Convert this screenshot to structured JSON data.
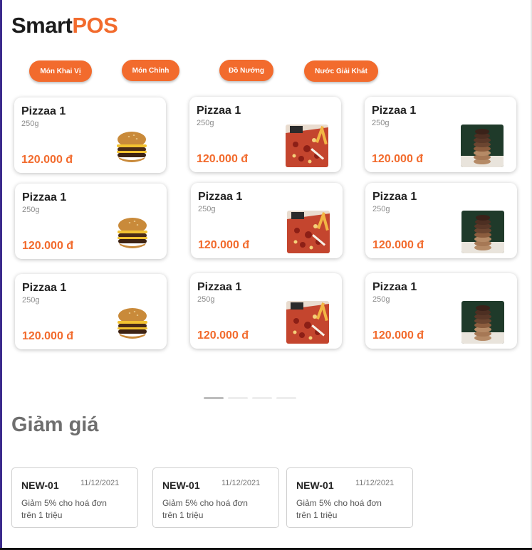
{
  "brand": {
    "part1": "Smart",
    "part2": "POS",
    "accent_color": "#f26b2d"
  },
  "categories": [
    {
      "label": "Món Khai Vị"
    },
    {
      "label": "Món Chính"
    },
    {
      "label": "Đồ Nướng"
    },
    {
      "label": "Nước Giải Khát"
    }
  ],
  "products": [
    {
      "name": "Pizzaa 1",
      "weight": "250g",
      "price": "120.000 đ",
      "image": "burger"
    },
    {
      "name": "Pizzaa 1",
      "weight": "250g",
      "price": "120.000 đ",
      "image": "pizza"
    },
    {
      "name": "Pizzaa 1",
      "weight": "250g",
      "price": "120.000 đ",
      "image": "cookies"
    },
    {
      "name": "Pizzaa 1",
      "weight": "250g",
      "price": "120.000 đ",
      "image": "burger"
    },
    {
      "name": "Pizzaa 1",
      "weight": "250g",
      "price": "120.000 đ",
      "image": "pizza"
    },
    {
      "name": "Pizzaa 1",
      "weight": "250g",
      "price": "120.000 đ",
      "image": "cookies"
    },
    {
      "name": "Pizzaa 1",
      "weight": "250g",
      "price": "120.000 đ",
      "image": "burger"
    },
    {
      "name": "Pizzaa 1",
      "weight": "250g",
      "price": "120.000 đ",
      "image": "pizza"
    },
    {
      "name": "Pizzaa 1",
      "weight": "250g",
      "price": "120.000 đ",
      "image": "cookies"
    }
  ],
  "pagination": {
    "pages": 4,
    "active": 1
  },
  "discounts": {
    "title": "Giảm giá",
    "items": [
      {
        "code": "NEW-01",
        "date": "11/12/2021",
        "description": "Giảm 5% cho hoá đơn trên 1  triệu"
      },
      {
        "code": "NEW-01",
        "date": "11/12/2021",
        "description": "Giảm 5% cho hoá đơn trên 1  triệu"
      },
      {
        "code": "NEW-01",
        "date": "11/12/2021",
        "description": "Giảm 5% cho hoá đơn trên 1  triệu"
      }
    ]
  }
}
